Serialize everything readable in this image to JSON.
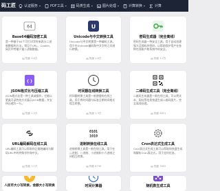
{
  "site": {
    "logo_text": "码工匠"
  },
  "nav": [
    {
      "label": "认证服务",
      "icon": "badge-icon"
    },
    {
      "label": "PDF工具",
      "icon": "pdf-icon"
    },
    {
      "label": "码类生成",
      "icon": "code-icon"
    },
    {
      "label": "图片处理",
      "icon": "image-icon"
    },
    {
      "label": "计算转换",
      "icon": "calculator-icon"
    },
    {
      "label": "计算",
      "icon": "sigma-icon"
    }
  ],
  "colors": {
    "topbar": "#1c2435",
    "page_bg": "#ededf0",
    "card_bg": "#ffffff",
    "accent": "#3da54a"
  },
  "cards": [
    {
      "title": "Base64编码加密工具",
      "icon": "base64-icon",
      "description": "是一种基于64个可打印字符来表示二进制数据的方法，常见于URL、Cookie、网页中传输少量二进制数据。",
      "meta": "热度 3.6万"
    },
    {
      "title": "Unicode与中文转换工具",
      "icon": "unicode-icon",
      "description": "Unicode与中文转换是一种编码工具，用于在Unicode编码和中文字符之间进行转换。",
      "meta": "热度 1.8万"
    },
    {
      "title": "密码生成器（完全离线）",
      "icon": "key-icon",
      "description": "密码生成器一种安全工具，用于自动创建强大且随机的密码，以帮助保护用户在各种在线账户和系统中的安全。",
      "meta": "热度 1.2万"
    },
    {
      "title": "JSON格式化与压缩工具",
      "icon": "json-icon",
      "description": "JSON格式化是一种工具或操作，它能以更具可读性的方式展示JSON数据，并支持压缩为一行。",
      "meta": "热度 1.5万"
    },
    {
      "title": "时间戳在线转换工具",
      "icon": "clock-icon",
      "description": "时间戳转换工具是一款便捷的在线工具，用于将时间戳与标准日期时间格式相互转换。",
      "meta": "热度 1.3万"
    },
    {
      "title": "二维码生成工具（完全离线）",
      "icon": "qrcode-icon",
      "description": "二维码生成器是一款在线工具，可以将文本、网址等信息快速生成二维码图片，完全离线处理。",
      "meta": "热度 9821"
    },
    {
      "title": "URL编码解码在线工具",
      "icon": "url-icon",
      "description": "URL编码工具可以帮助你正确地编码与解码URL中的特殊字符和中文。",
      "meta": "热度 1.1万"
    },
    {
      "title": "进制转换在线工具",
      "icon": "binary-icon",
      "description": "进制转换工具是一款在线工具，用于在二进制、八进制、十进制和十六进制之间相互转换。",
      "meta": "热度 8730"
    },
    {
      "title": "Cron表达式生成工具",
      "icon": "gear-icon",
      "description": "Cron表达式生成工具可以帮助你快速生成和解析Cron表达式，用于定时任务。",
      "meta": "热度 7652"
    },
    {
      "title": "人民币大小写转换，金额大小写转换",
      "icon": "yuan-icon",
      "description": "",
      "meta": ""
    },
    {
      "title": "时间计算器",
      "icon": "timer-icon",
      "description": "",
      "meta": ""
    },
    {
      "title": "随机数生成工具",
      "icon": "dice-icon",
      "description": "",
      "meta": ""
    }
  ]
}
